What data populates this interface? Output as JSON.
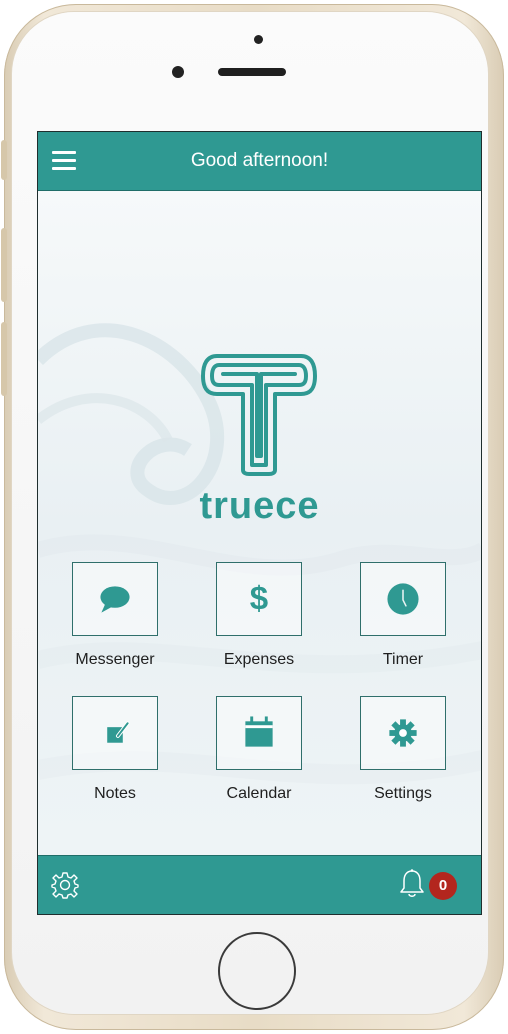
{
  "header": {
    "title": "Good afternoon!"
  },
  "brand": {
    "name": "truece"
  },
  "tiles": [
    {
      "label": "Messenger",
      "icon": "chat-bubble-icon"
    },
    {
      "label": "Expenses",
      "icon": "dollar-icon"
    },
    {
      "label": "Timer",
      "icon": "clock-icon"
    },
    {
      "label": "Notes",
      "icon": "note-edit-icon"
    },
    {
      "label": "Calendar",
      "icon": "calendar-icon"
    },
    {
      "label": "Settings",
      "icon": "gear-icon"
    }
  ],
  "footer": {
    "notification_count": "0"
  },
  "colors": {
    "accent": "#2f9992",
    "badge": "#b3261e",
    "tile_border": "#2f6f6b"
  }
}
